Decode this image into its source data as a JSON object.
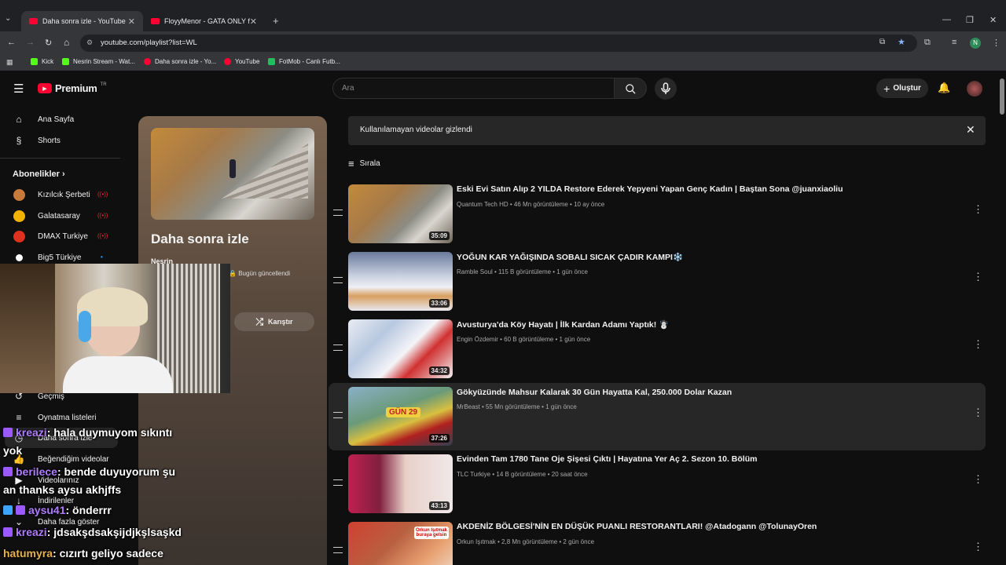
{
  "browser": {
    "tabs": [
      {
        "title": "Daha sonra izle - YouTube"
      },
      {
        "title": "FloyyMenor - GATA ONLY ft. Cr"
      }
    ],
    "url": "youtube.com/playlist?list=WL",
    "bookmarks": [
      "Kick",
      "Nesrin Stream - Wat...",
      "Daha sonra izle - Yo...",
      "YouTube",
      "FotMob - Canlı Futb..."
    ],
    "profile_initial": "N"
  },
  "header": {
    "logo_text": "Premium",
    "logo_badge": "TR",
    "search_placeholder": "Ara",
    "create_label": "Oluştur"
  },
  "sidebar": {
    "items": [
      {
        "label": "Ana Sayfa"
      },
      {
        "label": "Shorts"
      }
    ],
    "subscriptions_heading": "Abonelikler",
    "channels": [
      {
        "name": "Kızılcık Şerbeti",
        "color": "#c97a3a"
      },
      {
        "name": "Galatasaray",
        "color": "#f2b300"
      },
      {
        "name": "DMAX Turkiye",
        "color": "#e0301e"
      },
      {
        "name": "Big5 Türkiye",
        "color": "#ffffff"
      }
    ],
    "you_items": [
      {
        "label": "Geçmiş"
      },
      {
        "label": "Oynatma listeleri"
      },
      {
        "label": "Daha sonra izle"
      },
      {
        "label": "Beğendiğim videolar"
      },
      {
        "label": "Videolarınız"
      },
      {
        "label": "İndirilenler"
      },
      {
        "label": "Daha fazla göster"
      }
    ]
  },
  "playlist": {
    "title": "Daha sonra izle",
    "owner": "Nesrin",
    "updated": "Bugün güncellendi",
    "shuffle_label": "Karıştır"
  },
  "banner": {
    "text": "Kullanılamayan videolar gizlendi"
  },
  "sort_label": "Sırala",
  "videos": [
    {
      "title": "Eski Evi Satın Alıp 2 YILDA Restore Ederek Yepyeni Yapan Genç Kadın | Baştan Sona @juanxiaoliu",
      "meta": "Quantum Tech HD • 46 Mn görüntüleme • 10 ay önce",
      "duration": "35:09"
    },
    {
      "title": "YOĞUN KAR YAĞIŞINDA SOBALI SICAK ÇADIR KAMPI❄️",
      "meta": "Ramble Soul • 115 B görüntüleme • 1 gün önce",
      "duration": "33:06"
    },
    {
      "title": "Avusturya'da Köy Hayatı | İlk Kardan Adamı Yaptık! ☃️",
      "meta": "Engin Özdemir • 60 B görüntüleme • 1 gün önce",
      "duration": "34:32"
    },
    {
      "title": "Gökyüzünde Mahsur Kalarak 30 Gün Hayatta Kal, 250.000 Dolar Kazan",
      "meta": "MrBeast • 55 Mn görüntüleme • 1 gün önce",
      "duration": "37:26"
    },
    {
      "title": "Evinden Tam 1780 Tane Oje Şişesi Çıktı | Hayatına Yer Aç 2. Sezon 10. Bölüm",
      "meta": "TLC Turkiye • 14 B görüntüleme • 20 saat önce",
      "duration": "43:13"
    },
    {
      "title": "AKDENİZ BÖLGESİ'NİN EN DÜŞÜK PUANLI RESTORANTLARI! @Atadogann @TolunayOren",
      "meta": "Orkun Işıtmak • 2,8 Mn görüntüleme • 2 gün önce",
      "duration": ""
    }
  ],
  "thumb_texts": {
    "t4": "GÜN 29",
    "t6": "Orkun Işıtmak buraya gelsin"
  },
  "chat": [
    {
      "user": "kreazi",
      "message": ": hala duymuyom sıkıntı",
      "wrap": "yok",
      "color": "#b07cff"
    },
    {
      "user": "berilece",
      "message": ": bende duyuyorum şu",
      "wrap": "an thanks aysu akhjffs",
      "color": "#b07cff"
    },
    {
      "user": "aysu41",
      "message": ": önderrr",
      "wrap": "",
      "color": "#b07cff"
    },
    {
      "user": "kreazi",
      "message": ": jdsakşdsakşijdjkşlsaşkd",
      "wrap": "",
      "color": "#b07cff"
    },
    {
      "user": "hatumyra",
      "message": ": cızırtı geliyo sadece",
      "wrap": "",
      "color": "#e6b24a"
    }
  ]
}
